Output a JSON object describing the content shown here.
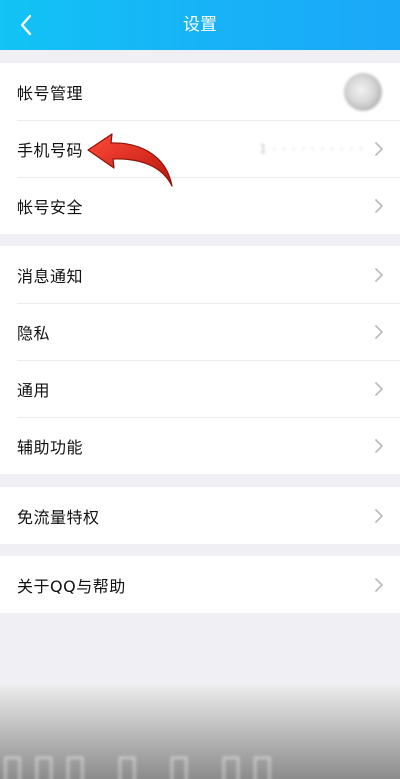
{
  "header": {
    "title": "设置",
    "back_icon": "chevron-left-icon"
  },
  "groups": [
    {
      "items": [
        {
          "label": "帐号管理",
          "trailing": "avatar"
        },
        {
          "label": "手机号码",
          "value": "1 · · · · · · · · · ·"
        },
        {
          "label": "帐号安全"
        }
      ]
    },
    {
      "items": [
        {
          "label": "消息通知"
        },
        {
          "label": "隐私"
        },
        {
          "label": "通用"
        },
        {
          "label": "辅助功能"
        }
      ]
    },
    {
      "items": [
        {
          "label": "免流量特权"
        }
      ]
    },
    {
      "items": [
        {
          "label": "关于QQ与帮助"
        }
      ]
    }
  ],
  "annotation": {
    "icon": "red-curved-arrow-icon",
    "color": "#e02a1c"
  },
  "colors": {
    "header": "#17b3f7",
    "background": "#f0f0f4",
    "chevron": "#bdbdbd"
  }
}
